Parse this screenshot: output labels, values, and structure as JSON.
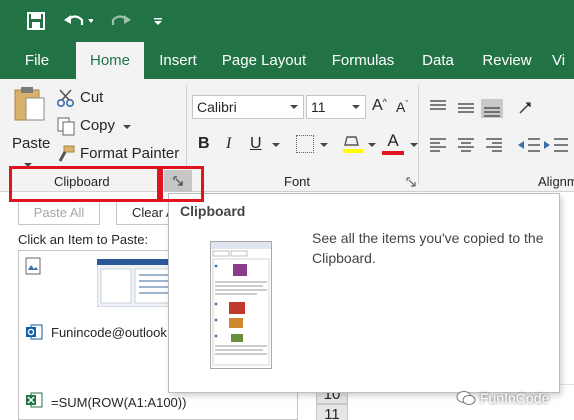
{
  "tabs": [
    "File",
    "Home",
    "Insert",
    "Page Layout",
    "Formulas",
    "Data",
    "Review",
    "Vi"
  ],
  "clipboard_group": {
    "paste_label": "Paste",
    "cut_label": "Cut",
    "copy_label": "Copy",
    "format_painter_label": "Format Painter",
    "group_label": "Clipboard"
  },
  "font_group": {
    "font_name": "Calibri",
    "font_size": "11",
    "bold": "B",
    "italic": "I",
    "underline": "U",
    "group_label": "Font"
  },
  "alignment_group": {
    "group_label": "Alignm"
  },
  "clipboard_pane": {
    "paste_all_label": "Paste All",
    "clear_all_label": "Clear A",
    "instruction": "Click an Item to Paste:",
    "items": [
      "Funincode@outlook.",
      "=SUM(ROW(A1:A100))"
    ]
  },
  "sheet": {
    "row_numbers": [
      "10",
      "11"
    ]
  },
  "tooltip": {
    "title": "Clipboard",
    "description": "See all the items you've copied to the Clipboard."
  },
  "watermark": {
    "text": "FunInCode"
  },
  "colors": {
    "excel_green": "#217346",
    "highlight_red": "#e0141e",
    "ribbon_bg": "#f3f3f3"
  }
}
